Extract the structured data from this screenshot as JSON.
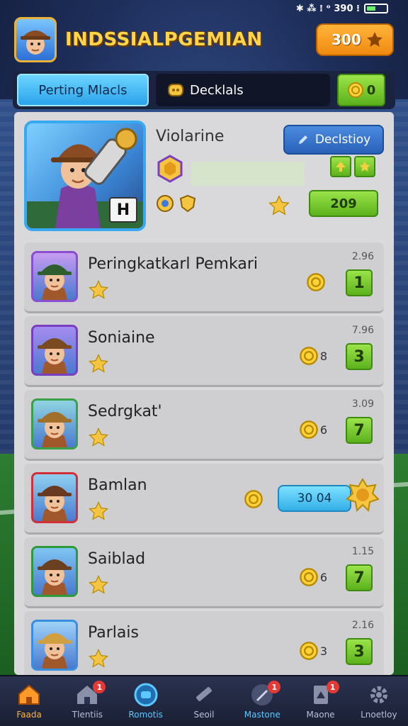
{
  "status_bar": {
    "text": "✱ ⁂ ⁞ ᵒ 390 ⁝"
  },
  "header": {
    "title": "INDSSIALPGEMIAN",
    "coins": "300"
  },
  "tabs": {
    "active_label": "Perting Mlacls",
    "secondary_label": "Decklals",
    "coins_value": "0"
  },
  "featured": {
    "name": "Violarine",
    "badge_letter": "H",
    "details_label": "Declstioy",
    "score": "209",
    "progress": 0.0
  },
  "players": [
    {
      "name": "Peringkatkarl Pemkari",
      "value": "2.96",
      "token_count": "",
      "rank": "1",
      "frame": "#8a4fd0",
      "bg": "#c69cf0",
      "hat": "#2e5e2e"
    },
    {
      "name": "Soniaine",
      "value": "7.96",
      "token_count": "8",
      "rank": "3",
      "frame": "#7a3fc0",
      "bg": "#a58cf0",
      "hat": "#7a4a20"
    },
    {
      "name": "Sedrgkat'",
      "value": "3.09",
      "token_count": "6",
      "rank": "7",
      "frame": "#3aa04a",
      "bg": "#8fd4e0",
      "hat": "#a0702a"
    },
    {
      "name": "Bamlan",
      "value": "",
      "token_count": "",
      "rank": "",
      "score": "30 04",
      "frame": "#d0303a",
      "bg": "#8fd0f0",
      "hat": "#6a3a20"
    },
    {
      "name": "Saiblad",
      "value": "1.15",
      "token_count": "6",
      "rank": "7",
      "frame": "#2e9a3a",
      "bg": "#7ec4f0",
      "hat": "#6a4020"
    },
    {
      "name": "Parlais",
      "value": "2.16",
      "token_count": "3",
      "rank": "3",
      "frame": "#3a8ee0",
      "bg": "#9ed2f8",
      "hat": "#d0a040"
    }
  ],
  "nav": [
    {
      "label": "Faada",
      "icon": "home-icon",
      "badge": ""
    },
    {
      "label": "Tlentiis",
      "icon": "house-icon",
      "badge": "1"
    },
    {
      "label": "Romotis",
      "icon": "gamepad-icon",
      "badge": ""
    },
    {
      "label": "Seoil",
      "icon": "slash-icon",
      "badge": ""
    },
    {
      "label": "Mastone",
      "icon": "rocket-icon",
      "badge": "1"
    },
    {
      "label": "Maone",
      "icon": "card-icon",
      "badge": "1"
    },
    {
      "label": "Lnoetloy",
      "icon": "gear-icon",
      "badge": ""
    }
  ],
  "colors": {
    "accent_orange": "#f08a10",
    "accent_green": "#5cb21c",
    "accent_blue": "#2ba3ea",
    "panel_bg": "#d9d9dc"
  }
}
